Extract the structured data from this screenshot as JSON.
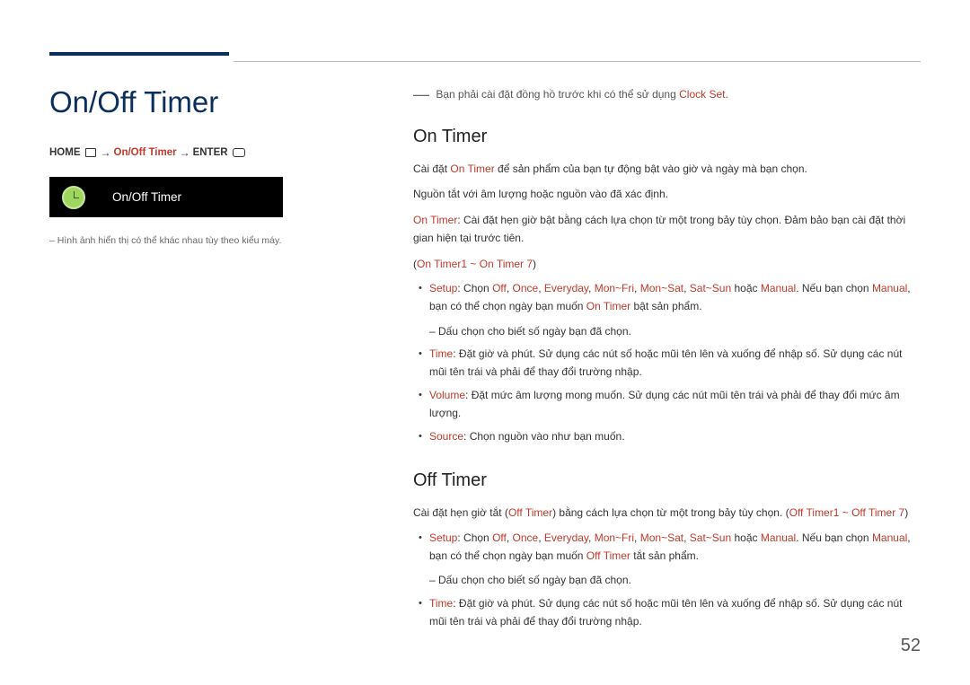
{
  "page_title": "On/Off Timer",
  "breadcrumb": {
    "home": "HOME",
    "mid": "On/Off Timer",
    "enter": "ENTER"
  },
  "menu_box_label": "On/Off Timer",
  "left_note": "– Hình ảnh hiển thị có thể khác nhau tùy theo kiểu máy.",
  "top_notice_prefix": "Bạn phải cài đặt đồng hồ trước khi có thể sử dụng ",
  "top_notice_link": "Clock Set",
  "on_timer": {
    "heading": "On Timer",
    "line1_a": "Cài đặt ",
    "line1_b": "On Timer",
    "line1_c": " để sản phẩm của bạn tự động bật vào giờ và ngày mà bạn chọn.",
    "line2": "Nguồn tắt với âm lượng hoặc nguồn vào đã xác định.",
    "line3_a": "On Timer",
    "line3_b": ": Cài đặt hẹn giờ bật bằng cách lựa chọn từ một trong bảy tùy chọn. Đảm bảo bạn cài đặt thời gian hiện tại trước tiên.",
    "range": "On Timer1 ~ On Timer 7",
    "setup_label": "Setup",
    "setup_text_a": ": Chọn ",
    "setup_off": "Off",
    "setup_once": "Once",
    "setup_everyday": "Everyday",
    "setup_monfri": "Mon~Fri",
    "setup_monsat": "Mon~Sat",
    "setup_satsun": "Sat~Sun",
    "setup_or": " hoặc ",
    "setup_manual": "Manual",
    "setup_text_b": ". Nếu bạn chọn ",
    "setup_text_c": ", bạn có thể chọn ngày bạn muốn ",
    "setup_text_d": " bật sản phẩm.",
    "check_note": "Dấu chọn cho biết số ngày bạn đã chọn.",
    "time_label": "Time",
    "time_text": ": Đặt giờ và phút. Sử dụng các nút số hoặc mũi tên lên và xuống để nhập số. Sử dụng các nút mũi tên trái và phải để thay đổi trường nhập.",
    "volume_label": "Volume",
    "volume_text": ": Đặt mức âm lượng mong muốn. Sử dụng các nút mũi tên trái và phải để thay đổi mức âm lượng.",
    "source_label": "Source",
    "source_text": ": Chọn nguồn vào như bạn muốn."
  },
  "off_timer": {
    "heading": "Off Timer",
    "line1_a": "Cài đặt hẹn giờ tắt (",
    "line1_b": "Off Timer",
    "line1_c": ") bằng cách lựa chọn từ một trong bảy tùy chọn. (",
    "range": "Off Timer1 ~ Off Timer 7",
    "line1_d": ")",
    "setup_text_d": " tắt sản phẩm."
  },
  "page_number": "52"
}
